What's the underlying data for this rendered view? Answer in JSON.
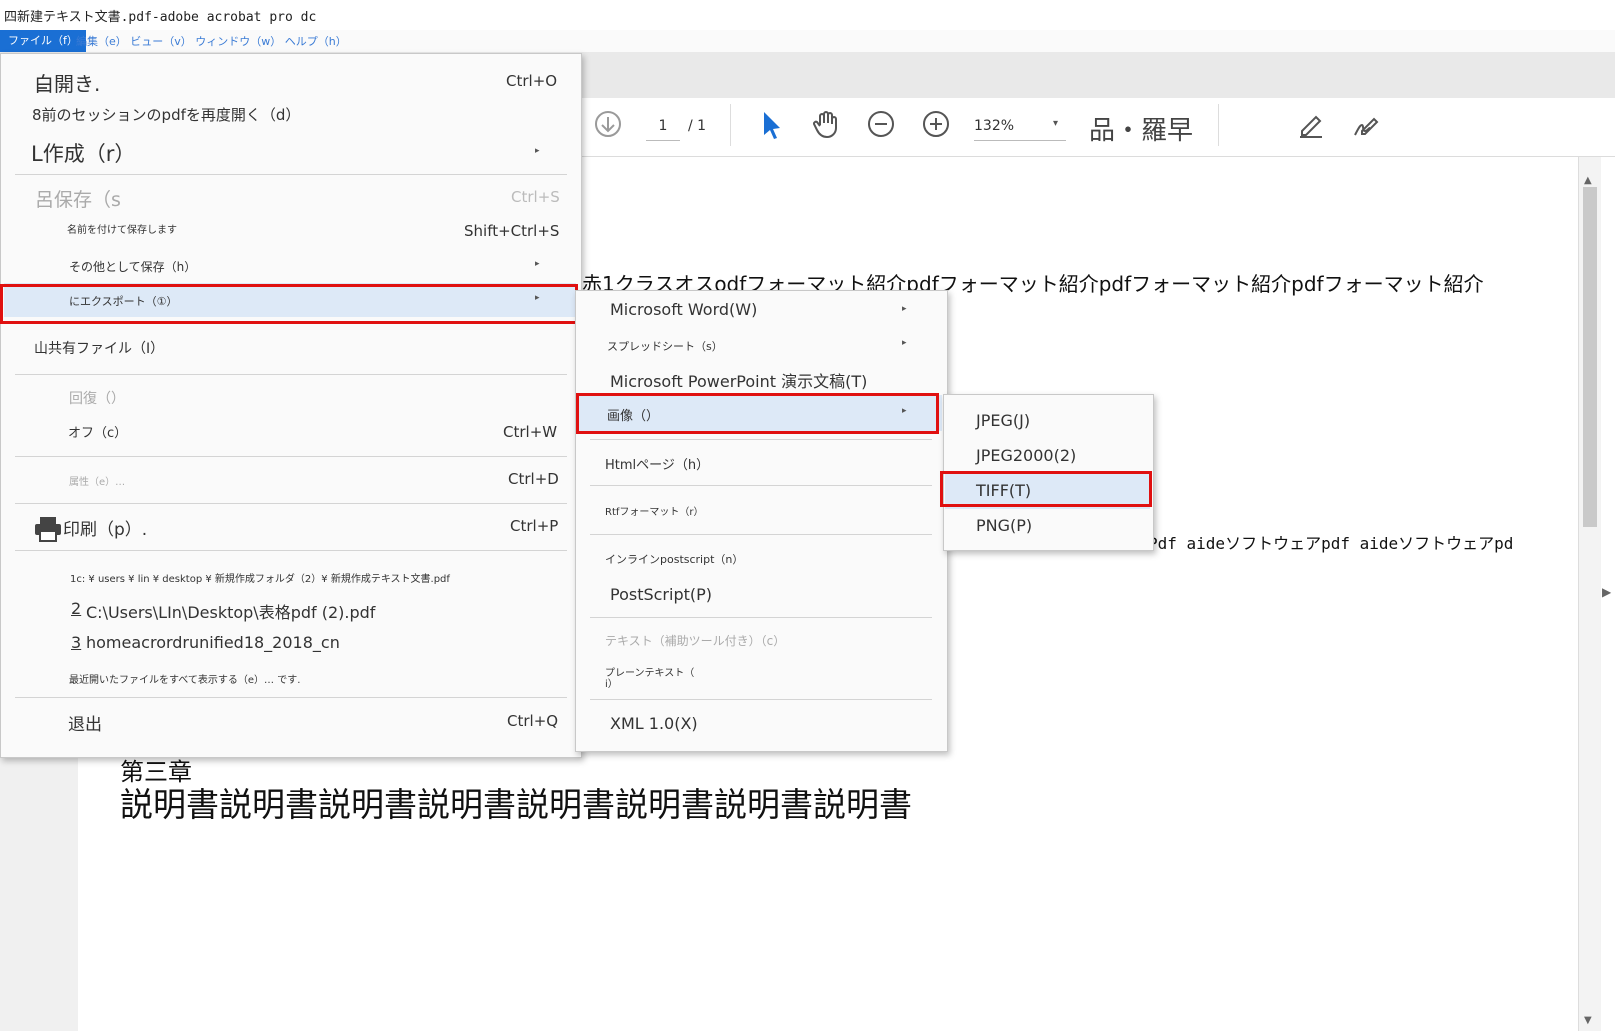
{
  "window": {
    "title": "四新建テキスト文書.pdf-adobe acrobat pro dc"
  },
  "menubar": {
    "file": "ファイル（f）",
    "rest": "編集（e） ビュー（v） ウィンドウ（w） ヘルプ（h）"
  },
  "toolbar": {
    "page_current": "1",
    "page_total": "/ 1",
    "zoom": "132%",
    "zoom_arrow": "▾",
    "extra_text": "品・羅早"
  },
  "document": {
    "line1": "赤1クラスオスodfフォーマット紹介pdfフォーマット紹介pdfフォーマット紹介pdfフォーマット紹介",
    "line2": "Pdf aideソフトウェアpdf aideソフトウェアpd",
    "chapter": "第三章",
    "body": "説明書説明書説明書説明書説明書説明書説明書説明書"
  },
  "file_menu": {
    "open": "白開き.",
    "open_sc": "Ctrl+O",
    "reopen": "8前のセッションのpdfを再度開く（d）",
    "create": "L作成（r）",
    "save": "呂保存（s",
    "save_sc": "Ctrl+S",
    "save_as": "名前を付けて保存します",
    "save_as_sc": "Shift+Ctrl+S",
    "save_other": "その他として保存（h）",
    "export": "にエクスポート（①）",
    "share": "山共有ファイル（I）",
    "revert": "回復（）",
    "close": "オフ（c）",
    "close_sc": "Ctrl+W",
    "properties": "属性（e）…",
    "properties_sc": "Ctrl+D",
    "print": "印刷（p）.",
    "print_sc": "Ctrl+P",
    "recent1": "1c: ¥ users ¥ lin ¥ desktop ¥ 新規作成フォルダ（2）¥ 新規作成テキスト文書.pdf",
    "recent2_num": "2",
    "recent2": "C:\\Users\\LIn\\Desktop\\表格pdf (2).pdf",
    "recent3_num": "3",
    "recent3": "homeacrordrunified18_2018_cn",
    "show_all": "最近開いたファイルをすべて表示する（e）… です.",
    "exit": "退出",
    "exit_sc": "Ctrl+Q"
  },
  "export_menu": {
    "word": "Microsoft Word(W)",
    "spreadsheet": "スプレッドシート（s）",
    "powerpoint": "Microsoft PowerPoint 演示文稿(T)",
    "image": "画像（）",
    "html": "Htmlページ（h）",
    "rtf": "Rtfフォーマット（r）",
    "inline_ps": "インラインpostscript（n）",
    "postscript": "PostScript(P)",
    "text_access": "テキスト（補助ツール付き）（c）",
    "plain_text": "プレーンテキスト（",
    "plain_text2": "i）",
    "xml": "XML 1.0(X)"
  },
  "image_menu": {
    "jpeg": "JPEG(J)",
    "jpeg2000": "JPEG2000(2)",
    "tiff": "TIFF(T)",
    "png": "PNG(P)"
  },
  "ui": {
    "submenu_arrow": "▸",
    "scroll_up": "▲",
    "scroll_down": "▼",
    "panel_arrow": "▶"
  },
  "colors": {
    "highlight": "#dde9f7",
    "red_box": "#e01010",
    "menubar_active": "#1a6fd4"
  }
}
